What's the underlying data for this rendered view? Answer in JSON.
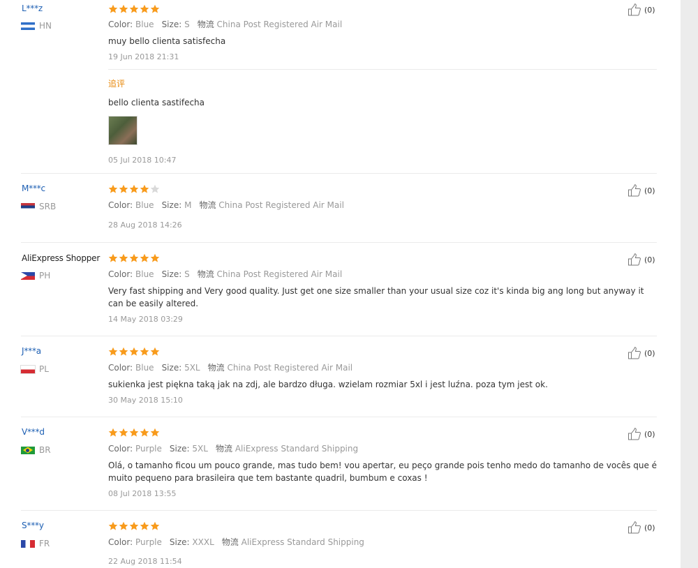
{
  "feedback": [
    {
      "user": "L***z",
      "country": "HN",
      "stars": 5,
      "color_label": "Color:",
      "color": "Blue",
      "size_label": "Size:",
      "size": "S",
      "ship_label": "物流",
      "shipping": "China Post Registered Air Mail",
      "content": "muy bello clienta satisfecha",
      "date": "19 Jun 2018 21:31",
      "append_tag": "追评",
      "append_content": "bello clienta sastifecha",
      "append_date": "05 Jul 2018 10:47",
      "helpful": "(0)"
    },
    {
      "user": "M***c",
      "country": "SRB",
      "stars": 4,
      "color_label": "Color:",
      "color": "Blue",
      "size_label": "Size:",
      "size": "M",
      "ship_label": "物流",
      "shipping": "China Post Registered Air Mail",
      "date": "28 Aug 2018 14:26",
      "helpful": "(0)"
    },
    {
      "user": "AliExpress Shopper",
      "country": "PH",
      "stars": 5,
      "color_label": "Color:",
      "color": "Blue",
      "size_label": "Size:",
      "size": "S",
      "ship_label": "物流",
      "shipping": "China Post Registered Air Mail",
      "content": "Very fast shipping and Very good quality. Just get one size smaller than your usual size coz it's kinda big ang long but anyway it can be easily altered.",
      "date": "14 May 2018 03:29",
      "helpful": "(0)"
    },
    {
      "user": "J***a",
      "country": "PL",
      "stars": 5,
      "color_label": "Color:",
      "color": "Blue",
      "size_label": "Size:",
      "size": "5XL",
      "ship_label": "物流",
      "shipping": "China Post Registered Air Mail",
      "content": "sukienka jest piękna taką jak na zdj, ale bardzo długa. wzielam rozmiar 5xl i jest luźna. poza tym jest ok.",
      "date": "30 May 2018 15:10",
      "helpful": "(0)"
    },
    {
      "user": "V***d",
      "country": "BR",
      "stars": 5,
      "color_label": "Color:",
      "color": "Purple",
      "size_label": "Size:",
      "size": "5XL",
      "ship_label": "物流",
      "shipping": "AliExpress Standard Shipping",
      "content": "Olá, o tamanho ficou um pouco grande, mas tudo bem! vou apertar, eu peço grande pois tenho medo do tamanho de vocês que é muito pequeno para brasileira que tem bastante quadril, bumbum e coxas !",
      "date": "08 Jul 2018 13:55",
      "helpful": "(0)"
    },
    {
      "user": "S***y",
      "country": "FR",
      "stars": 5,
      "color_label": "Color:",
      "color": "Purple",
      "size_label": "Size:",
      "size": "XXXL",
      "ship_label": "物流",
      "shipping": "AliExpress Standard Shipping",
      "date": "22 Aug 2018 11:54",
      "helpful": "(0)"
    }
  ],
  "colors": {
    "star_on": "#f89b1c",
    "star_off": "#d9d9d9",
    "link": "#1d5fb3",
    "append": "#e88a0e"
  },
  "icons": {
    "star": "star-icon",
    "thumb": "thumbs-up-icon"
  }
}
